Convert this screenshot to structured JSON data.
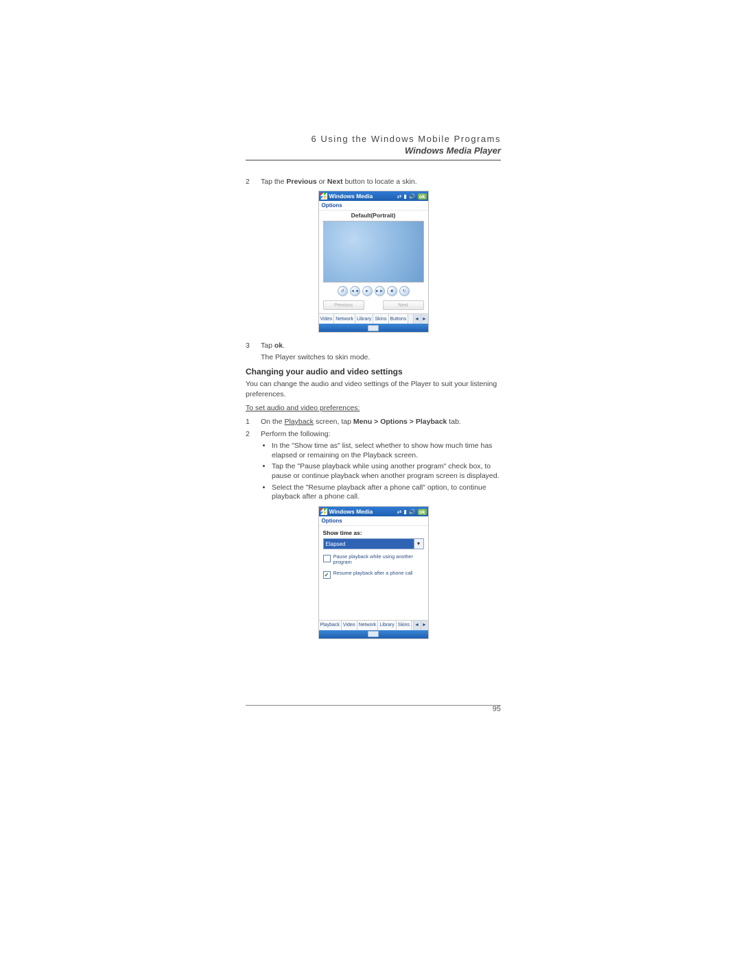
{
  "header": {
    "chapter_number": "6",
    "chapter_title": "Using the Windows Mobile Programs",
    "section_title": "Windows Media Player"
  },
  "step2": {
    "num": "2",
    "pre": "Tap the ",
    "b1": "Previous",
    "mid": " or ",
    "b2": "Next",
    "post": " button to locate a skin."
  },
  "shot1": {
    "titlebar": {
      "app": "Windows Media",
      "ok": "ok"
    },
    "menu": "Options",
    "skin_name": "Default(Portrait)",
    "prev_btn": "Previous",
    "next_btn": "Next",
    "tabs": [
      "Video",
      "Network",
      "Library",
      "Skins",
      "Buttons"
    ],
    "player_glyphs": {
      "shuffle": "↺",
      "prev": "◄◄",
      "play": "►",
      "next": "►►",
      "stop": "■",
      "repeat": "↻"
    }
  },
  "step3": {
    "num": "3",
    "pre": "Tap ",
    "b1": "ok",
    "post": ".",
    "sub": "The Player switches to skin mode."
  },
  "heading1": "Changing your audio and video settings",
  "para1": "You can change the audio and video settings of the Player to suit your listening preferences.",
  "proc_title": "To set audio and video preferences:",
  "proc1": {
    "num": "1",
    "pre": "On the ",
    "link": "Playback",
    "mid": " screen, tap ",
    "bold": "Menu > Options > Playback",
    "post": " tab."
  },
  "proc2": {
    "num": "2",
    "txt": "Perform the following:"
  },
  "bullets": [
    "In the \"Show time as\" list, select whether to show how much time has elapsed or remaining on the Playback screen.",
    "Tap the \"Pause playback while using another program\" check box, to pause or continue playback when another program screen is displayed.",
    "Select the \"Resume playback after a phone call\" option, to continue playback after a phone call."
  ],
  "shot2": {
    "titlebar": {
      "app": "Windows Media",
      "ok": "ok"
    },
    "menu": "Options",
    "show_time_label": "Show time as:",
    "dropdown_value": "Elapsed",
    "chk1": {
      "checked": false,
      "label": "Pause playback while using another program"
    },
    "chk2": {
      "checked": true,
      "label": "Resume playback after a phone call"
    },
    "tabs": [
      "Playback",
      "Video",
      "Network",
      "Library",
      "Skins"
    ]
  },
  "page_number": "95"
}
